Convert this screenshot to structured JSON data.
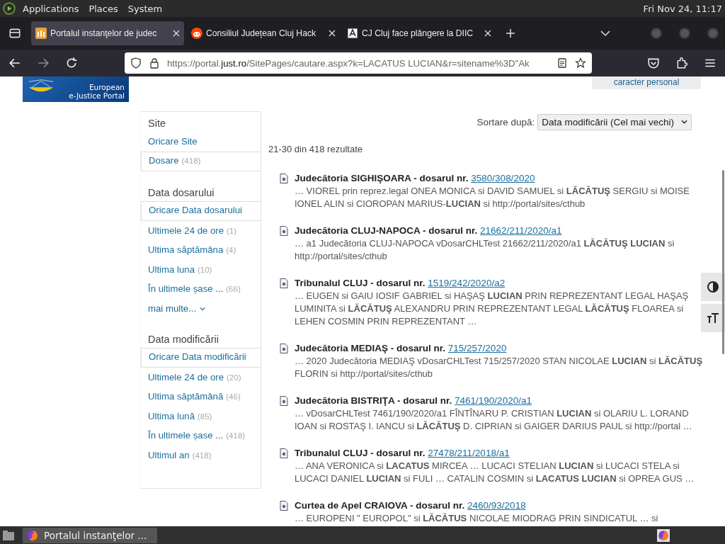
{
  "top_panel": {
    "menus": [
      "Applications",
      "Places",
      "System"
    ],
    "clock": "Fri Nov 24, 11:17"
  },
  "tabs": [
    {
      "title": "Portalul instanţelor de judec",
      "selected": true,
      "kind": "portal"
    },
    {
      "title": "Consiliul Județean Cluj Hack",
      "selected": false,
      "kind": "reddit"
    },
    {
      "title": "CJ Cluj face plângere la DIIC",
      "selected": false,
      "kind": "news"
    }
  ],
  "address_bar": {
    "url_start": "https://portal.",
    "url_domain": "just.ro",
    "url_rest": "/SitePages/cautare.aspx?k=LACATUS LUCIAN&r=sitename%3D\"Ak"
  },
  "logo": {
    "line_1": "European",
    "line_2": "e-Justice Portal"
  },
  "header_button": "caracter personal",
  "refiners": [
    {
      "title": "Site",
      "items": [
        {
          "label": "Oricare Site",
          "selected": false
        },
        {
          "label": "Dosare",
          "count": "(418)",
          "selected": true
        }
      ]
    },
    {
      "title": "Data dosarului",
      "items": [
        {
          "label": "Oricare Data dosarului",
          "selected": true
        },
        {
          "label": "Ultimele 24 de ore",
          "count": "(1)",
          "selected": false
        },
        {
          "label": "Ultima săptămâna",
          "count": "(4)",
          "selected": false
        },
        {
          "label": "Ultima luna",
          "count": "(10)",
          "selected": false
        },
        {
          "label": "În ultimele șase ...",
          "count": "(66)",
          "selected": false
        }
      ],
      "more": "mai multe..."
    },
    {
      "title": "Data modificării",
      "items": [
        {
          "label": "Oricare Data modificării",
          "selected": true
        },
        {
          "label": "Ultimele 24 de ore",
          "count": "(20)",
          "selected": false
        },
        {
          "label": "Ultima săptămână",
          "count": "(46)",
          "selected": false
        },
        {
          "label": "Ultima lună",
          "count": "(85)",
          "selected": false
        },
        {
          "label": "În ultimele șase ...",
          "count": "(418)",
          "selected": false
        },
        {
          "label": "Ultimul an",
          "count": "(418)",
          "selected": false
        }
      ]
    }
  ],
  "sort": {
    "label": "Sortare după:",
    "value": "Data modificării (Cel mai vechi)"
  },
  "result_count": "21-30 din 418 rezultate",
  "results": [
    {
      "title": "Judecătoria SIGHIŞOARA - dosarul nr.",
      "number": "3580/308/2020",
      "snippet": "… VIOREL prin reprez.legal ONEA MONICA si DAVID SAMUEL si **LĂCĂTUŞ** SERGIU si MOISE IONEL ALIN si CIOROPAN MARIUS-**LUCIAN** si http://portal/sites/cthub"
    },
    {
      "title": "Judecătoria CLUJ-NAPOCA - dosarul nr.",
      "number": "21662/211/2020/a1",
      "snippet": "… a1 Judecătoria CLUJ-NAPOCA vDosarCHLTest 21662/211/2020/a1 **LĂCĂTUŞ LUCIAN** si http://portal/sites/cthub"
    },
    {
      "title": "Tribunalul CLUJ - dosarul nr.",
      "number": "1519/242/2020/a2",
      "snippet": "… EUGEN si GAIU IOSIF GABRIEL si HAŞAŞ **LUCIAN** PRIN REPREZENTANT LEGAL HAŞAŞ LUMINITA si **LĂCĂTUŞ** ALEXANDRU PRIN REPREZENTANT LEGAL **LĂCĂTUŞ** FLOAREA si LEHEN COSMIN PRIN REPREZENTANT …"
    },
    {
      "title": "Judecătoria MEDIAŞ - dosarul nr.",
      "number": "715/257/2020",
      "snippet": "… 2020 Judecătoria MEDIAŞ vDosarCHLTest 715/257/2020 STAN NICOLAE **LUCIAN** si **LĂCĂTUŞ** FLORIN si http://portal/sites/cthub"
    },
    {
      "title": "Judecătoria BISTRIŢA - dosarul nr.",
      "number": "7461/190/2020/a1",
      "snippet": "… vDosarCHLTest 7461/190/2020/a1 FÎNTÎNARU P. CRISTIAN **LUCIAN** si OLARIU L. LORAND IOAN si ROSTAŞ I. IANCU si **LĂCĂTUŞ** D. CIPRIAN si GAIGER DARIUS PAUL si http://portal …"
    },
    {
      "title": "Tribunalul CLUJ - dosarul nr.",
      "number": "27478/211/2018/a1",
      "snippet": "… ANA VERONICA si **LACATUS** MIRCEA … LUCACI STELIAN **LUCIAN** si LUCACI STELA si LUCACI DANIEL **LUCIAN** si FULI … CATALIN COSMIN si **LACATUS LUCIAN** si OPREA GUS …"
    },
    {
      "title": "Curtea de Apel CRAIOVA - dosarul nr.",
      "number": "2460/93/2018",
      "snippet": "… EUROPENI \" EUROPOL\" si **LĂCĂTUS** NICOLAE MIODRAG PRIN SINDICATUL … si"
    }
  ],
  "taskbar": {
    "window_title": "Portalul instanţelor ..."
  }
}
